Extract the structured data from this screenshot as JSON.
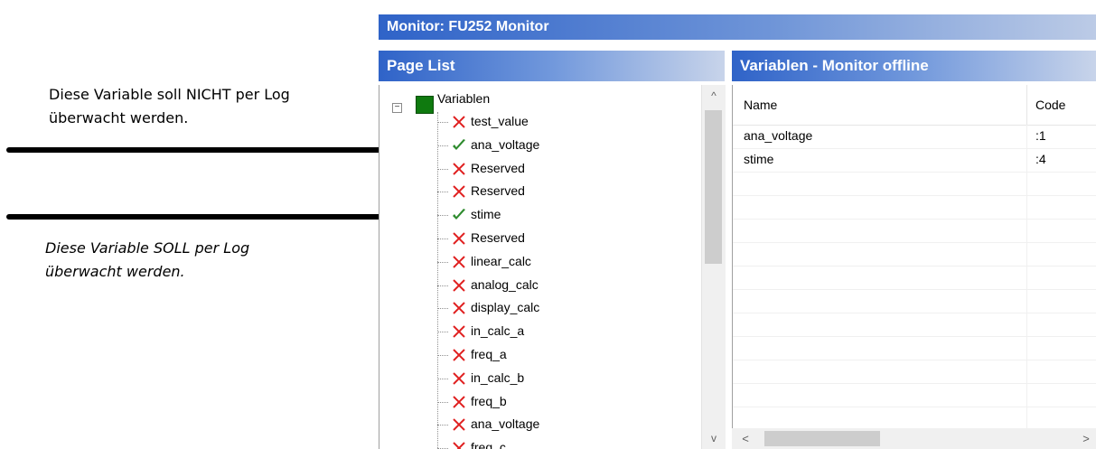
{
  "annotations": {
    "note_top_line1": "Diese Variable soll NICHT per Log",
    "note_top_line2": "überwacht werden.",
    "note_bottom_line1": "Diese Variable SOLL per Log",
    "note_bottom_line2": "überwacht werden."
  },
  "window": {
    "title": "Monitor: FU252 Monitor"
  },
  "page_list": {
    "header": "Page List",
    "root": {
      "label": "Variablen",
      "toggle": "−"
    },
    "items": [
      {
        "label": "test_value",
        "icon": "red-x-icon"
      },
      {
        "label": "ana_voltage",
        "icon": "green-check-icon"
      },
      {
        "label": "Reserved",
        "icon": "red-x-icon"
      },
      {
        "label": "Reserved",
        "icon": "red-x-icon"
      },
      {
        "label": "stime",
        "icon": "green-check-icon"
      },
      {
        "label": "Reserved",
        "icon": "red-x-icon"
      },
      {
        "label": "linear_calc",
        "icon": "red-x-icon"
      },
      {
        "label": "analog_calc",
        "icon": "red-x-icon"
      },
      {
        "label": "display_calc",
        "icon": "red-x-icon"
      },
      {
        "label": "in_calc_a",
        "icon": "red-x-icon"
      },
      {
        "label": "freq_a",
        "icon": "red-x-icon"
      },
      {
        "label": "in_calc_b",
        "icon": "red-x-icon"
      },
      {
        "label": "freq_b",
        "icon": "red-x-icon"
      },
      {
        "label": "ana_voltage",
        "icon": "red-x-icon"
      },
      {
        "label": "freq_c",
        "icon": "red-x-icon"
      }
    ]
  },
  "monitor": {
    "header": "Variablen - Monitor offline",
    "columns": [
      "Name",
      "Code"
    ],
    "rows": [
      {
        "name": "ana_voltage",
        "code": ":1"
      },
      {
        "name": "stime",
        "code": ":4"
      }
    ]
  },
  "scrollbar_glyphs": {
    "up": "^",
    "down": "v",
    "left": "<",
    "right": ">"
  },
  "colors": {
    "accent": "#2f63c8",
    "ok": "#2e8b2e",
    "error": "#e02020",
    "root_box": "#0f7a0f"
  }
}
